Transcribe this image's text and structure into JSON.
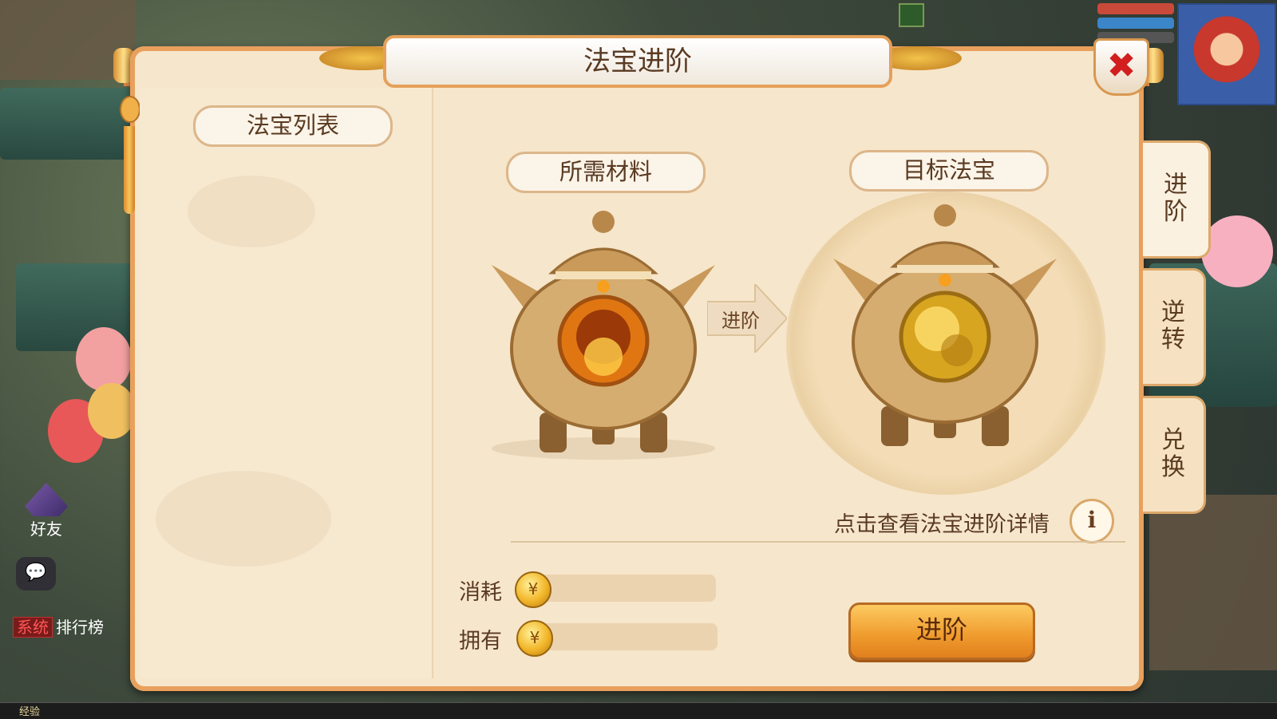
{
  "dialog": {
    "title": "法宝进阶",
    "close_icon": "close-x-icon"
  },
  "left_panel": {
    "header": "法宝列表"
  },
  "materials": {
    "header": "所需材料"
  },
  "target": {
    "header": "目标法宝"
  },
  "arrow": {
    "label": "进阶"
  },
  "detail": {
    "text": "点击查看法宝进阶详情",
    "info_label": "i"
  },
  "cost": {
    "consume_label": "消耗",
    "own_label": "拥有",
    "coin_icon": "gold-coin-icon"
  },
  "advance_button": {
    "label": "进阶"
  },
  "side_tabs": [
    {
      "label_top": "进",
      "label_bottom": "阶",
      "active": true
    },
    {
      "label_top": "逆",
      "label_bottom": "转",
      "active": false
    },
    {
      "label_top": "兑",
      "label_bottom": "换",
      "active": false
    }
  ],
  "hud": {
    "friend_label": "好友",
    "system_tag": "系统",
    "system_text": "排行榜",
    "exp_label": "经验"
  },
  "colors": {
    "dialog_bg": "#f6e6cb",
    "frame_orange": "#e8a05c",
    "text_brown": "#5a3a22",
    "button_gold": "#ef9a2c",
    "close_red": "#d21e1e"
  }
}
